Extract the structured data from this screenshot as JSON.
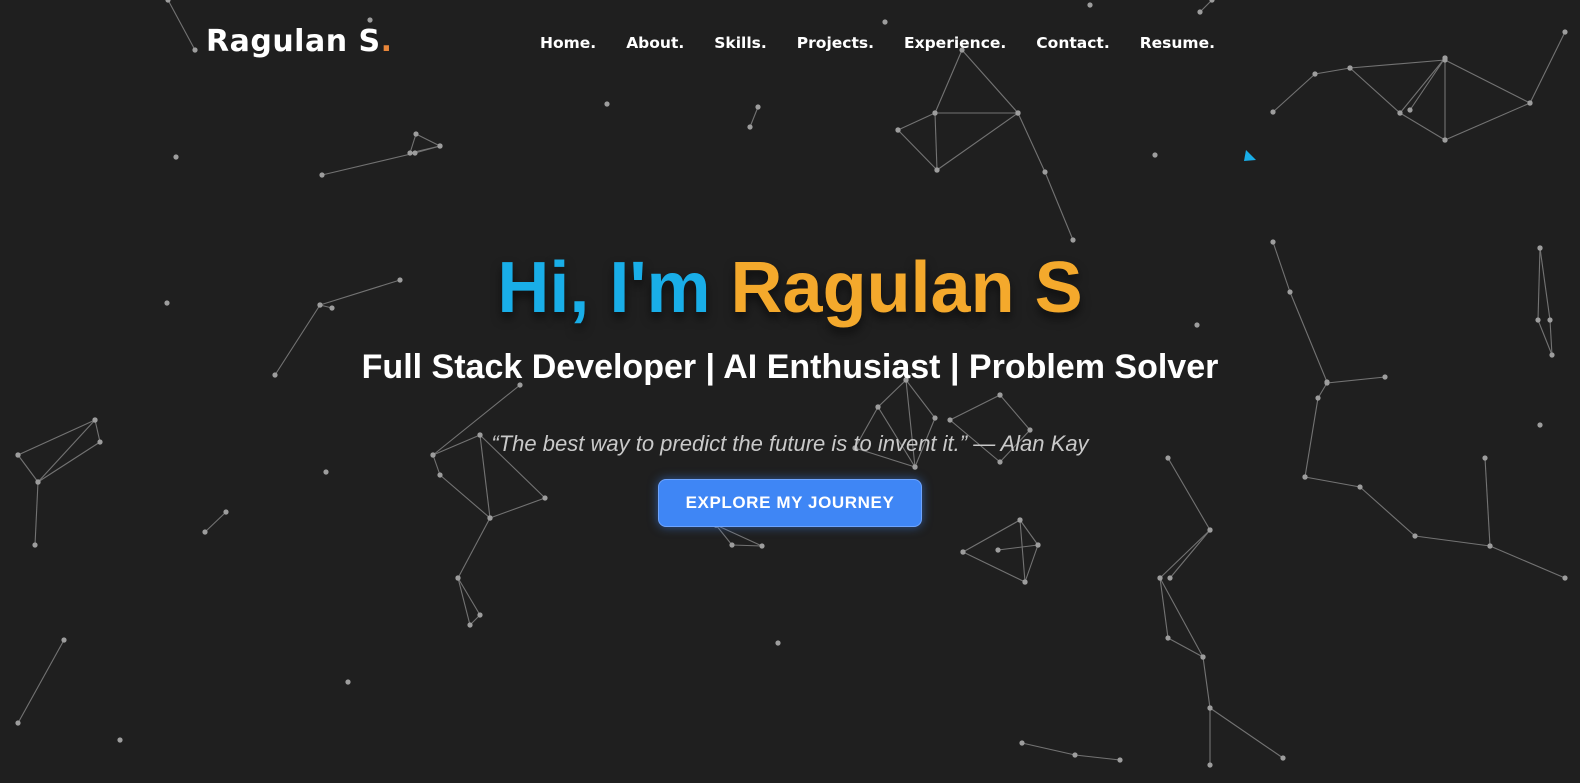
{
  "header": {
    "logo_name": "Ragulan S",
    "logo_dot": "."
  },
  "nav": {
    "items": [
      {
        "label": "Home."
      },
      {
        "label": "About."
      },
      {
        "label": "Skills."
      },
      {
        "label": "Projects."
      },
      {
        "label": "Experience."
      },
      {
        "label": "Contact."
      },
      {
        "label": "Resume."
      }
    ]
  },
  "hero": {
    "greeting": "Hi, I'm",
    "name": "Ragulan S",
    "subtitle": "Full Stack Developer | AI Enthusiast | Problem Solver",
    "quote": "“The best way to predict the future is to invent it.” — Alan Kay",
    "cta_label": "EXPLORE MY JOURNEY"
  },
  "theme": {
    "background": "#1f1f1f",
    "greeting_color": "#19aee8",
    "name_color": "#f4a92c",
    "logo_accent": "#e8863a",
    "cta_color": "#3f86f5",
    "network_color": "#9a9a9a"
  }
}
